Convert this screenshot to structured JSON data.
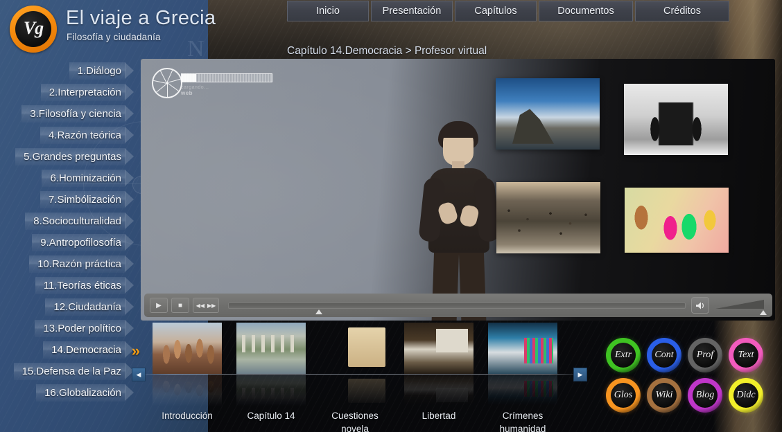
{
  "header": {
    "logo_text": "Vg",
    "title": "El viaje a Grecia",
    "subtitle": "Filosofía y ciudadanía"
  },
  "topnav": {
    "items": [
      {
        "label": "Inicio"
      },
      {
        "label": "Presentación"
      },
      {
        "label": "Capítulos"
      },
      {
        "label": "Documentos"
      },
      {
        "label": "Créditos"
      }
    ]
  },
  "breadcrumb": "Capítulo 14.Democracia > Profesor virtual",
  "sidebar": {
    "items": [
      {
        "label": "1.Diálogo"
      },
      {
        "label": "2.Interpretación"
      },
      {
        "label": "3.Filosofía y ciencia"
      },
      {
        "label": "4.Razón teórica"
      },
      {
        "label": "5.Grandes preguntas"
      },
      {
        "label": "6.Hominización"
      },
      {
        "label": "7.Simbólización"
      },
      {
        "label": "8.Socioculturalidad"
      },
      {
        "label": "9.Antropofilosofía"
      },
      {
        "label": "10.Razón práctica"
      },
      {
        "label": "11.Teorías éticas"
      },
      {
        "label": "12.Ciudadanía"
      },
      {
        "label": "13.Poder político"
      },
      {
        "label": "14.Democracia"
      },
      {
        "label": "15.Defensa de la Paz"
      },
      {
        "label": "16.Globalización"
      }
    ],
    "active_index": 13,
    "active_marker": "»"
  },
  "player": {
    "loading_label": "cargando…",
    "loading_sub": "web",
    "progress_percent": 16,
    "controls": {
      "play": "▶",
      "stop": "■",
      "prev": "◀◀",
      "next": "▶▶",
      "speaker": "speaker-icon"
    },
    "seek_position_percent": 19,
    "volume_percent": 100
  },
  "strip": {
    "prev_arrow": "◀",
    "next_arrow": "▶",
    "thumbs": [
      {
        "caption": "Introducción",
        "art": "t1"
      },
      {
        "caption": "Capítulo 14",
        "art": "t2"
      },
      {
        "caption": "Cuestiones novela",
        "art": "t3"
      },
      {
        "caption": "Libertad",
        "art": "t4"
      },
      {
        "caption": "Crímenes humanidad",
        "art": "t5"
      }
    ]
  },
  "circle_buttons": [
    {
      "label": "Extr",
      "color": "#3fc322"
    },
    {
      "label": "Cont",
      "color": "#2a5fe8"
    },
    {
      "label": "Prof",
      "color": "#646464"
    },
    {
      "label": "Text",
      "color": "#f25bbd"
    },
    {
      "label": "Glos",
      "color": "#f79420"
    },
    {
      "label": "Wiki",
      "color": "#a5713f"
    },
    {
      "label": "Blog",
      "color": "#bf36c9"
    },
    {
      "label": "Didc",
      "color": "#f2ef2a"
    }
  ],
  "background": {
    "watermark_letter": "N",
    "accent_color": "#f39c12",
    "panel_bg": "#0a0a0c"
  }
}
